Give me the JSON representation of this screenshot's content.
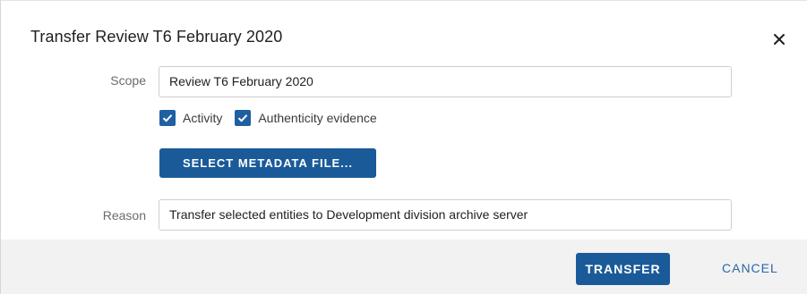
{
  "dialog": {
    "title": "Transfer Review T6 February 2020",
    "close_icon": "close-icon"
  },
  "scope": {
    "label": "Scope",
    "value": "Review T6 February 2020"
  },
  "options": [
    {
      "label": "Activity",
      "checked": true
    },
    {
      "label": "Authenticity evidence",
      "checked": true
    }
  ],
  "metadata_button": {
    "label": "SELECT METADATA FILE..."
  },
  "reason": {
    "label": "Reason",
    "value": "Transfer selected entities to Development division archive server"
  },
  "footer": {
    "transfer_label": "TRANSFER",
    "cancel_label": "CANCEL"
  },
  "colors": {
    "primary": "#1a5a99",
    "checkbox": "#1f5fa2",
    "link": "#2a67a6",
    "footer_bg": "#f2f2f2"
  }
}
